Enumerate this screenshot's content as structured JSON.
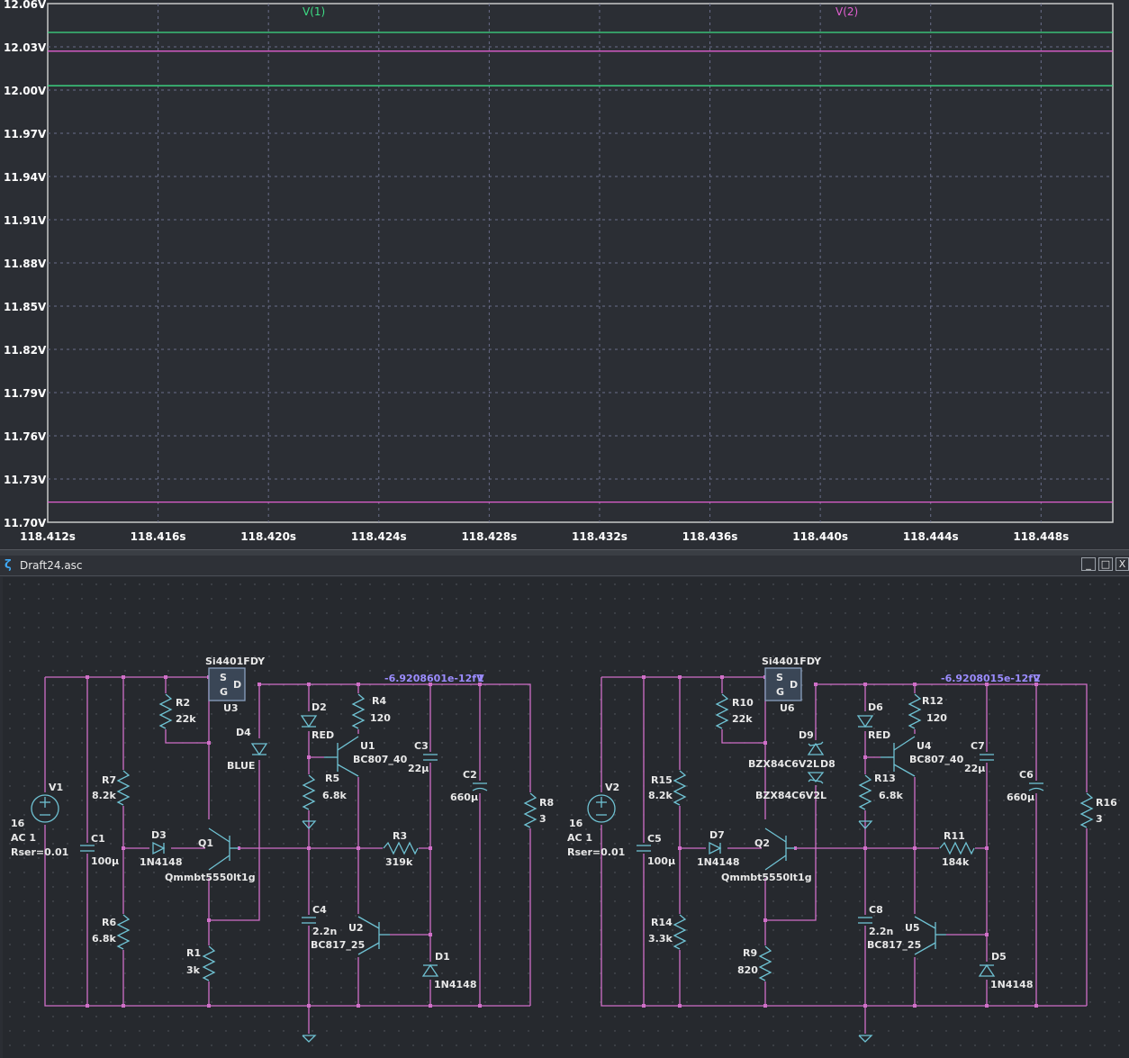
{
  "plot": {
    "traces": [
      {
        "name": "V(1)",
        "color": "#3ddc84"
      },
      {
        "name": "V(2)",
        "color": "#e25fd0"
      }
    ],
    "y_ticks": [
      "12.06V",
      "12.03V",
      "12.00V",
      "11.97V",
      "11.94V",
      "11.91V",
      "11.88V",
      "11.85V",
      "11.82V",
      "11.79V",
      "11.76V",
      "11.73V",
      "11.70V"
    ],
    "x_ticks": [
      "118.412s",
      "118.416s",
      "118.420s",
      "118.424s",
      "118.428s",
      "118.432s",
      "118.436s",
      "118.440s",
      "118.444s",
      "118.448s"
    ]
  },
  "chart_data": {
    "type": "line",
    "x": [
      118.412,
      118.4506
    ],
    "xlim": [
      118.412,
      118.4506
    ],
    "ylim": [
      11.7,
      12.06
    ],
    "series": [
      {
        "name": "V(1)",
        "segments": [
          [
            12.04,
            12.04
          ],
          [
            12.003,
            12.003
          ]
        ]
      },
      {
        "name": "V(2)",
        "segments": [
          [
            12.027,
            12.027
          ],
          [
            11.714,
            11.714
          ]
        ]
      }
    ],
    "grid": true
  },
  "schematic": {
    "title": "Draft24.asc",
    "win_minimize": "_",
    "win_maximize": "□",
    "win_close": "X",
    "left": {
      "mosfet_model": "Si4401FDY",
      "mosfet_s": "S",
      "mosfet_g": "G",
      "mosfet_d": "D",
      "mosfet_ref": "U3",
      "out_probe": "-6.9208601e-12fV",
      "out_net": "1",
      "V_ref": "V1",
      "V_val": "16",
      "V_ac": "AC 1",
      "V_rser": "Rser=0.01",
      "C1": "C1",
      "C1_val": "100µ",
      "R7": "R7",
      "R7_val": "8.2k",
      "R6": "R6",
      "R6_val": "6.8k",
      "R2": "R2",
      "R2_val": "22k",
      "D4": "D4",
      "D4_val": "BLUE",
      "D3": "D3",
      "D3_val": "1N4148",
      "Q1": "Q1",
      "Q1_val": "Qmmbt5550lt1g",
      "R1": "R1",
      "R1_val": "3k",
      "D2": "D2",
      "D2_val": "RED",
      "R4": "R4",
      "R4_val": "120",
      "U1": "U1",
      "U1_val": "BC807_40",
      "R5": "R5",
      "R5_val": "6.8k",
      "C3": "C3",
      "C3_val": "22µ",
      "C2": "C2",
      "C2_val": "660µ",
      "R8": "R8",
      "R8_val": "3",
      "R3": "R3",
      "R3_val": "319k",
      "C4": "C4",
      "C4_val": "2.2n",
      "U2": "U2",
      "U2_val": "BC817_25",
      "D1": "D1",
      "D1_val": "1N4148"
    },
    "right": {
      "mosfet_model": "Si4401FDY",
      "mosfet_s": "S",
      "mosfet_g": "G",
      "mosfet_d": "D",
      "mosfet_ref": "U6",
      "out_probe": "-6.9208015e-12fV",
      "out_net": "2",
      "V_ref": "V2",
      "V_val": "16",
      "V_ac": "AC 1",
      "V_rser": "Rser=0.01",
      "C5": "C5",
      "C5_val": "100µ",
      "R15": "R15",
      "R15_val": "8.2k",
      "R14": "R14",
      "R14_val": "3.3k",
      "R10": "R10",
      "R10_val": "22k",
      "D9": "D9",
      "D9_val": "BZX84C6V2L",
      "D8": "D8",
      "D8_val": "BZX84C6V2L",
      "D7": "D7",
      "D7_val": "1N4148",
      "Q2": "Q2",
      "Q2_val": "Qmmbt5550lt1g",
      "R9": "R9",
      "R9_val": "820",
      "D6": "D6",
      "D6_val": "RED",
      "R12": "R12",
      "R12_val": "120",
      "U4": "U4",
      "U4_val": "BC807_40",
      "R13": "R13",
      "R13_val": "6.8k",
      "C7": "C7",
      "C7_val": "22µ",
      "C6": "C6",
      "C6_val": "660µ",
      "R16": "R16",
      "R16_val": "3",
      "R11": "R11",
      "R11_val": "184k",
      "C8": "C8",
      "C8_val": "2.2n",
      "U5": "U5",
      "U5_val": "BC817_25",
      "D5": "D5",
      "D5_val": "1N4148"
    }
  }
}
